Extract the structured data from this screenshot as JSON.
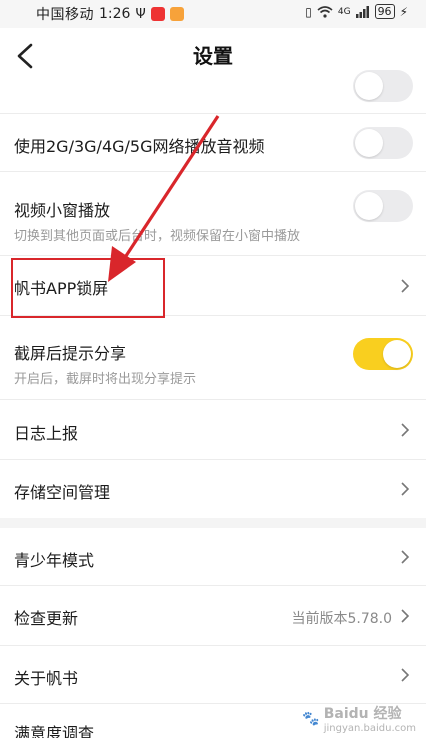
{
  "status_bar": {
    "carrier": "中国移动",
    "time": "1:26",
    "signal": "4G",
    "battery": "96"
  },
  "header": {
    "title": "设置"
  },
  "settings": {
    "row_network": {
      "label": "使用2G/3G/4G/5G网络播放音视频",
      "toggle_on": false
    },
    "row_pip": {
      "label": "视频小窗播放",
      "sub": "切换到其他页面或后台时，视频保留在小窗中播放",
      "toggle_on": false
    },
    "row_lock": {
      "label": "帆书APP锁屏"
    },
    "row_screenshot": {
      "label": "截屏后提示分享",
      "sub": "开启后，截屏时将出现分享提示",
      "toggle_on": true
    },
    "row_log": {
      "label": "日志上报"
    },
    "row_storage": {
      "label": "存储空间管理"
    },
    "row_teen": {
      "label": "青少年模式"
    },
    "row_update": {
      "label": "检查更新",
      "value": "当前版本5.78.0"
    },
    "row_about": {
      "label": "关于帆书"
    },
    "row_survey": {
      "label": "满意度调查"
    }
  },
  "colors": {
    "accent_toggle": "#f9cf1f",
    "annotation_red": "#d9262b"
  },
  "watermark": {
    "brand": "Baidu 经验",
    "url": "jingyan.baidu.com"
  }
}
